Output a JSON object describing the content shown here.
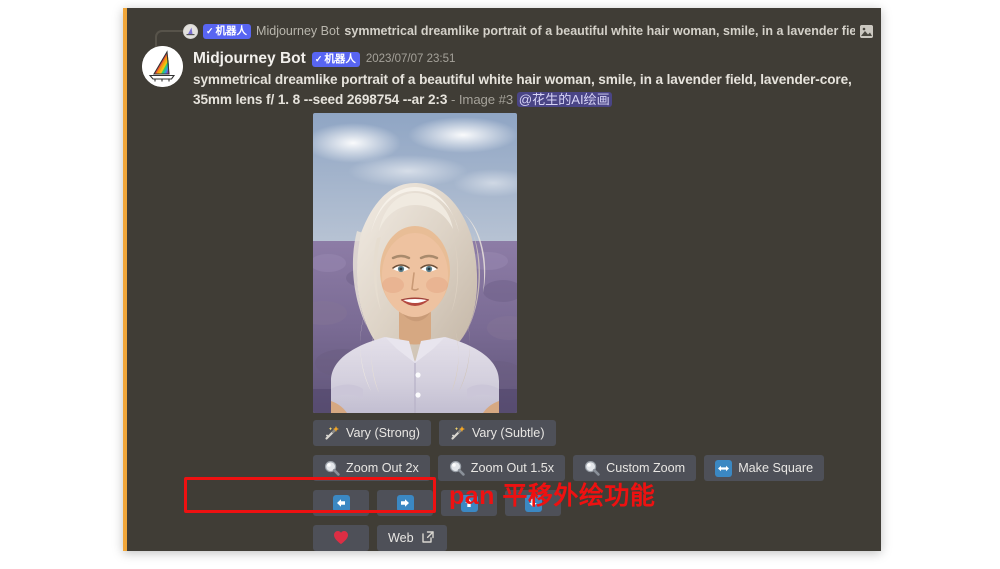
{
  "reply": {
    "bot_badge": "机器人",
    "check": "✓",
    "author": "Midjourney Bot",
    "preview_text": "symmetrical dreamlike portrait of a beautiful white hair woman, smile, in a lavender field, lav",
    "attachment_icon": "image-icon"
  },
  "message": {
    "author": "Midjourney Bot",
    "bot_badge": "机器人",
    "check": "✓",
    "timestamp": "2023/07/07 23:51",
    "prompt": "symmetrical dreamlike portrait of a beautiful white hair woman, smile, in a lavender field, lavender-core, 35mm lens f/ 1. 8 --seed 2698754 --ar 2:3",
    "image_label": "- Image #3",
    "mention": "@花生的AI绘画"
  },
  "image": {
    "alt": "AI generated portrait of a smiling white-haired woman in a lavender field"
  },
  "buttons": {
    "row1": [
      {
        "label": "Vary (Strong)",
        "icon": "magic-wand-icon"
      },
      {
        "label": "Vary (Subtle)",
        "icon": "magic-wand-icon"
      }
    ],
    "row2": [
      {
        "label": "Zoom Out 2x",
        "icon": "magnifier-icon"
      },
      {
        "label": "Zoom Out 1.5x",
        "icon": "magnifier-icon"
      },
      {
        "label": "Custom Zoom",
        "icon": "magnifier-icon"
      },
      {
        "label": "Make Square",
        "icon": "left-right-arrow-icon"
      }
    ],
    "row3": [
      {
        "label": "",
        "icon": "arrow-left-icon"
      },
      {
        "label": "",
        "icon": "arrow-right-icon"
      },
      {
        "label": "",
        "icon": "arrow-up-icon"
      },
      {
        "label": "",
        "icon": "arrow-down-icon"
      }
    ],
    "row4": [
      {
        "label": "",
        "icon": "heart-icon"
      },
      {
        "label": "Web",
        "icon": "external-link-icon"
      }
    ]
  },
  "annotation": {
    "text": "pan 平移外绘功能",
    "color": "#ee1111"
  },
  "colors": {
    "panel_bg": "#403d36",
    "left_accent": "#f0a63a",
    "button_bg": "#4e5058",
    "blurple": "#5865f2",
    "blue_tile": "#3b88c3",
    "heart": "#dd2e44",
    "mention_bg": "#4a4586"
  }
}
